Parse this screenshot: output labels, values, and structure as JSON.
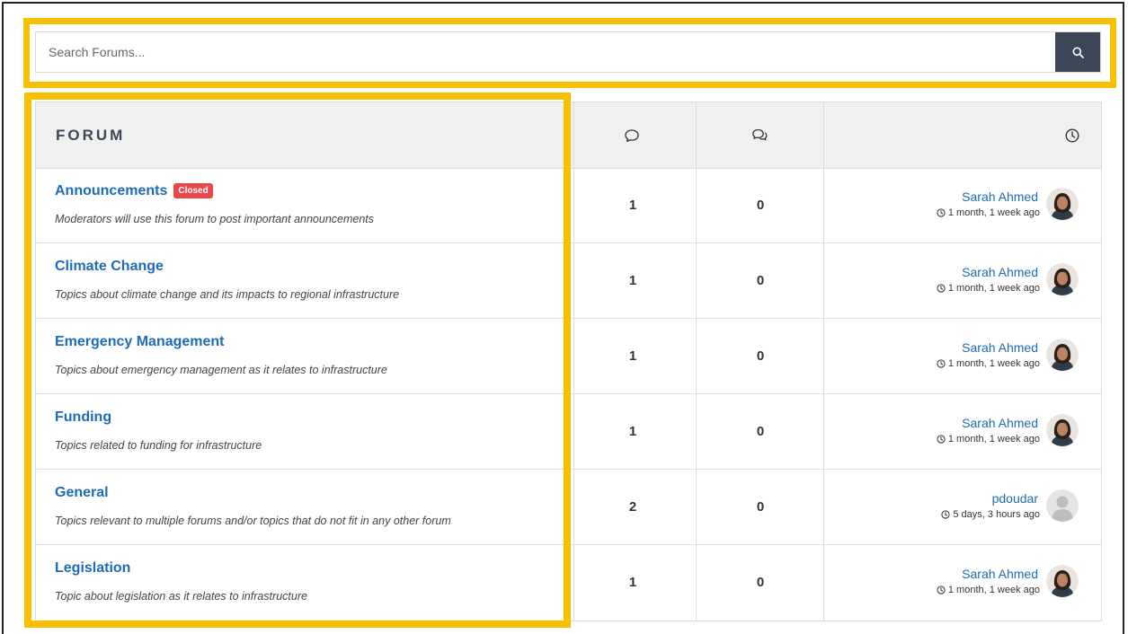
{
  "search": {
    "placeholder": "Search Forums...",
    "button_icon": "search-icon"
  },
  "header": {
    "forum_label": "FORUM",
    "topics_icon": "speech-bubble-icon",
    "replies_icon": "two-speech-bubbles-icon",
    "last_post_icon": "clock-icon"
  },
  "colors": {
    "highlight": "#f7c002",
    "link": "#1f6bb3",
    "badge": "#e8474c",
    "search_button": "#3b4656",
    "header_bg": "#f0f0f0"
  },
  "forums": [
    {
      "title": "Announcements",
      "badge": "Closed",
      "description": "Moderators will use this forum to post important announcements",
      "topics": "1",
      "replies": "0",
      "last_user": "Sarah Ahmed",
      "last_time": "1 month, 1 week ago",
      "avatar": "photo"
    },
    {
      "title": "Climate Change",
      "badge": "",
      "description": "Topics about climate change and its impacts to regional infrastructure",
      "topics": "1",
      "replies": "0",
      "last_user": "Sarah Ahmed",
      "last_time": "1 month, 1 week ago",
      "avatar": "photo"
    },
    {
      "title": "Emergency Management",
      "badge": "",
      "description": "Topics about emergency management as it relates to infrastructure",
      "topics": "1",
      "replies": "0",
      "last_user": "Sarah Ahmed",
      "last_time": "1 month, 1 week ago",
      "avatar": "photo"
    },
    {
      "title": "Funding",
      "badge": "",
      "description": "Topics related to funding for infrastructure",
      "topics": "1",
      "replies": "0",
      "last_user": "Sarah Ahmed",
      "last_time": "1 month, 1 week ago",
      "avatar": "photo"
    },
    {
      "title": "General",
      "badge": "",
      "description": "Topics relevant to multiple forums and/or topics that do not fit in any other forum",
      "topics": "2",
      "replies": "0",
      "last_user": "pdoudar",
      "last_time": "5 days, 3 hours ago",
      "avatar": "default"
    },
    {
      "title": "Legislation",
      "badge": "",
      "description": "Topic about legislation as it relates to infrastructure",
      "topics": "1",
      "replies": "0",
      "last_user": "Sarah Ahmed",
      "last_time": "1 month, 1 week ago",
      "avatar": "photo"
    }
  ]
}
